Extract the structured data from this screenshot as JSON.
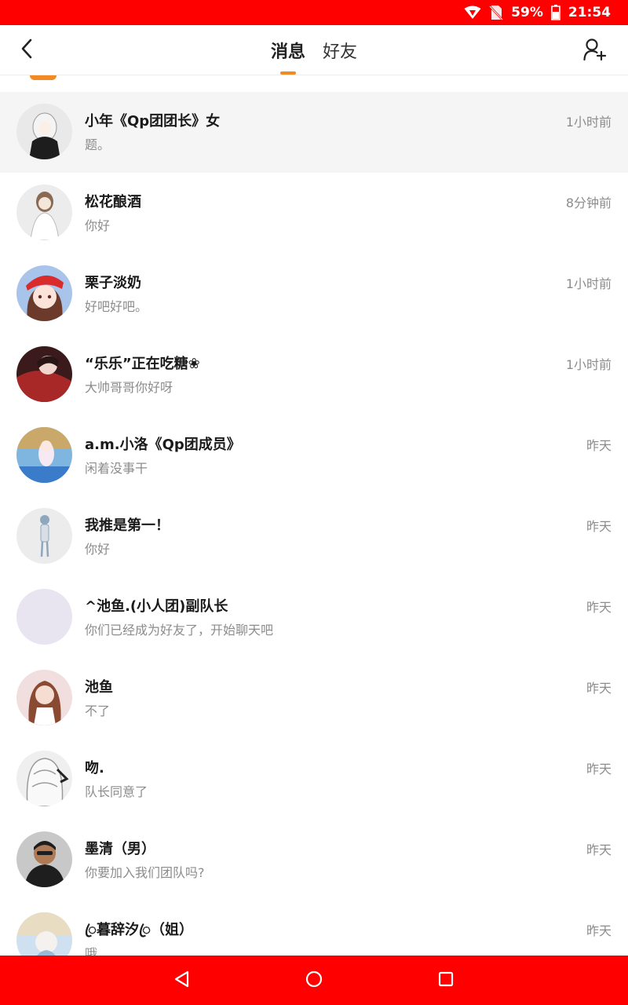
{
  "status_bar": {
    "battery": "59%",
    "time": "21:54"
  },
  "header": {
    "tabs": [
      {
        "label": "消息"
      },
      {
        "label": "好友"
      }
    ]
  },
  "conversations": [
    {
      "name": "小年《Qp团团长》女",
      "preview": "题。",
      "time": "1小时前"
    },
    {
      "name": "松花酿酒",
      "preview": "你好",
      "time": "8分钟前"
    },
    {
      "name": "栗子淡奶",
      "preview": "好吧好吧。",
      "time": "1小时前"
    },
    {
      "name": "“乐乐”正在吃糖❀",
      "preview": "大帅哥哥你好呀",
      "time": "1小时前"
    },
    {
      "name": "a.m.小洛《Qp团成员》",
      "preview": "闲着没事干",
      "time": "昨天"
    },
    {
      "name": "我推是第一！",
      "preview": "你好",
      "time": "昨天"
    },
    {
      "name": "^池鱼.(小人团)副队长",
      "preview": "你们已经成为好友了，开始聊天吧",
      "time": "昨天"
    },
    {
      "name": "池鱼",
      "preview": "不了",
      "time": "昨天"
    },
    {
      "name": "吻.",
      "preview": "队长同意了",
      "time": "昨天"
    },
    {
      "name": "墨清（男）",
      "preview": "你要加入我们团队吗?",
      "time": "昨天"
    },
    {
      "name": "ꦿ暮辞汐ꦿ（姐）",
      "preview": "哦",
      "time": "昨天"
    }
  ],
  "colors": {
    "status_bar": "#ff0000",
    "accent": "#f08a24",
    "nav_bar": "#ff0000"
  }
}
